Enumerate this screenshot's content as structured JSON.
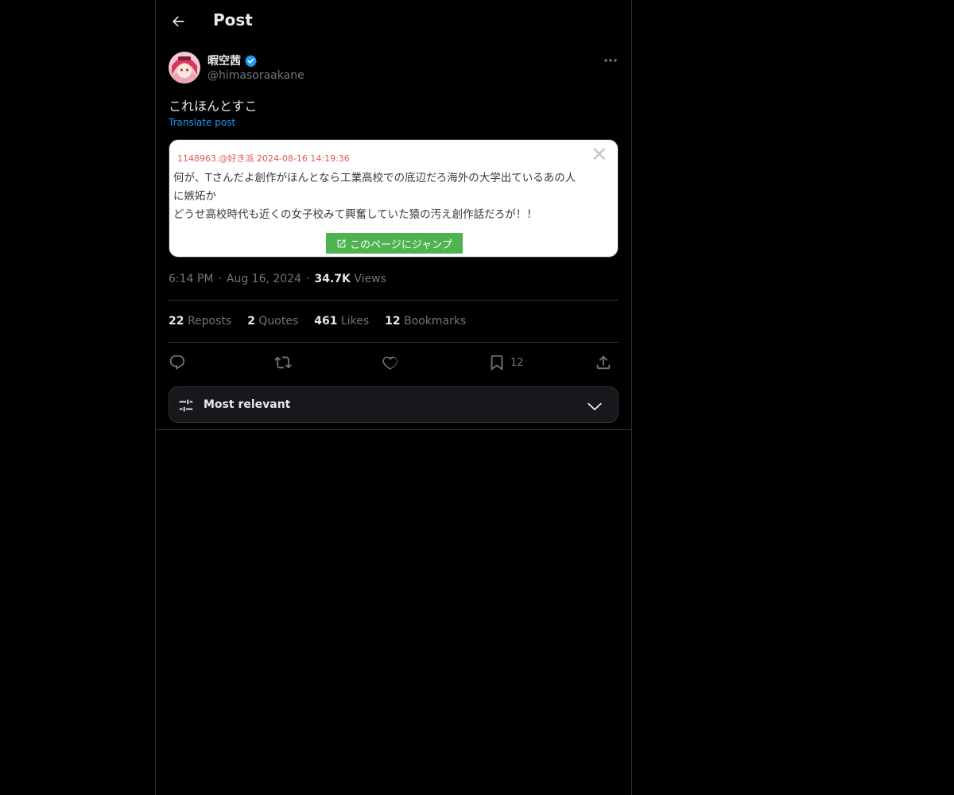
{
  "header": {
    "title": "Post",
    "back_icon": "arrow-left-icon"
  },
  "author": {
    "display_name": "暇空茜",
    "handle": "@himasoraakane",
    "verified": true,
    "verified_color": "#1d9bf0"
  },
  "post": {
    "text": "これほんとすこ",
    "translate_label": "Translate post",
    "time": "6:14 PM",
    "date": "Aug 16, 2024",
    "views_count": "34.7K",
    "views_label": "Views"
  },
  "media": {
    "meta": "1148963.@好き派 2024-08-16 14:19:36",
    "lines": [
      "何が、Tさんだよ創作がほんとなら工業高校での底辺だろ海外の大学出ているあの人",
      "に嫉妬か",
      "どうせ高校時代も近くの女子校みて興奮していた猿の汚え創作話だろが！！"
    ],
    "jump_label": "このページにジャンプ",
    "close_glyph": "✕"
  },
  "stats": {
    "reposts_count": "22",
    "reposts_label": "Reposts",
    "quotes_count": "2",
    "quotes_label": "Quotes",
    "likes_count": "461",
    "likes_label": "Likes",
    "bookmarks_count": "12",
    "bookmarks_label": "Bookmarks"
  },
  "actions": {
    "bookmark_count": "12"
  },
  "sort": {
    "label": "Most relevant"
  },
  "colors": {
    "accent": "#1d9bf0",
    "muted": "#71767b",
    "text": "#e7e9ea",
    "border": "#2f3336"
  }
}
